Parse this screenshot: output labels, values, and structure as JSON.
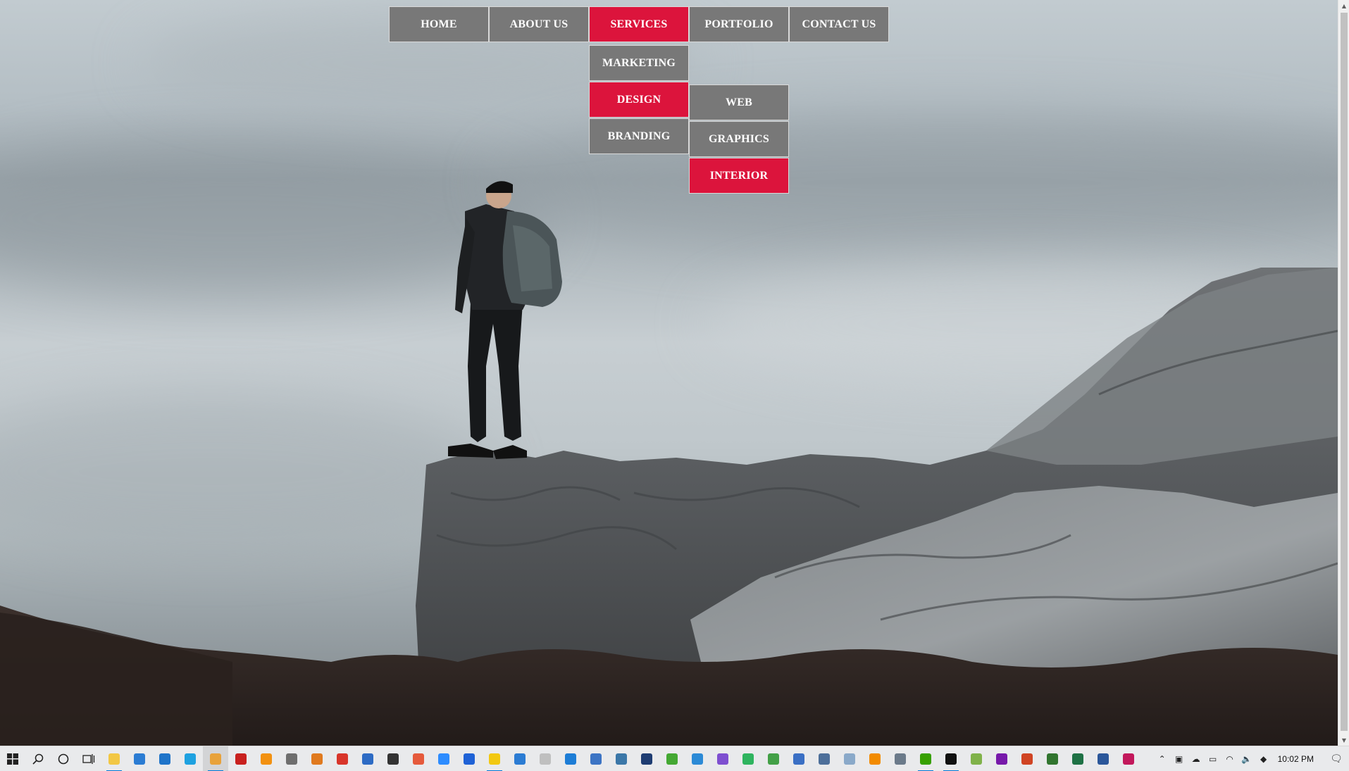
{
  "nav": {
    "items": [
      {
        "label": "HOME"
      },
      {
        "label": "ABOUT US"
      },
      {
        "label": "SERVICES"
      },
      {
        "label": "PORTFOLIO"
      },
      {
        "label": "CONTACT US"
      }
    ],
    "active_item": "SERVICES",
    "services_submenu": [
      {
        "label": "MARKETING"
      },
      {
        "label": "DESIGN"
      },
      {
        "label": "BRANDING"
      }
    ],
    "design_submenu": [
      {
        "label": "WEB"
      },
      {
        "label": "GRAPHICS"
      },
      {
        "label": "INTERIOR"
      }
    ],
    "colors": {
      "button_bg": "#787878",
      "active_bg": "#dc143c",
      "text": "#ffffff"
    }
  },
  "taskbar": {
    "start_icon": "windows-logo-icon",
    "search_icon": "search-icon",
    "cortana_icon": "cortana-circle-icon",
    "task_view_icon": "task-view-icon",
    "apps": [
      {
        "name": "file-explorer-icon",
        "color": "#f2c744"
      },
      {
        "name": "store-icon",
        "color": "#2b7cd3"
      },
      {
        "name": "mail-icon",
        "color": "#1f74c9"
      },
      {
        "name": "internet-explorer-icon",
        "color": "#1ea1e0"
      },
      {
        "name": "chrome-icon",
        "color": "#e8a23a"
      },
      {
        "name": "acrobat-icon",
        "color": "#c8211f"
      },
      {
        "name": "orange-app-icon",
        "color": "#f29111"
      },
      {
        "name": "calculator-icon",
        "color": "#6e6e6e"
      },
      {
        "name": "sublime-icon",
        "color": "#e07a1f"
      },
      {
        "name": "red-app-icon",
        "color": "#d8352a"
      },
      {
        "name": "terminal-icon",
        "color": "#2d6bc4"
      },
      {
        "name": "cmd-icon",
        "color": "#333333"
      },
      {
        "name": "snip-icon",
        "color": "#e55a3c"
      },
      {
        "name": "zoom-icon",
        "color": "#2d8cff"
      },
      {
        "name": "chat-icon",
        "color": "#1f62d6"
      },
      {
        "name": "sticky-notes-icon",
        "color": "#f2c811"
      },
      {
        "name": "photos-icon",
        "color": "#2b7cd3"
      },
      {
        "name": "document-icon",
        "color": "#bfbfbf"
      },
      {
        "name": "edge-icon",
        "color": "#1d7dd6"
      },
      {
        "name": "tool-icon",
        "color": "#3c74c4"
      },
      {
        "name": "python-icon",
        "color": "#3b77a8"
      },
      {
        "name": "intellij-icon",
        "color": "#1e3c72"
      },
      {
        "name": "anaconda-icon",
        "color": "#44a833"
      },
      {
        "name": "vscode-icon",
        "color": "#2c8ad6"
      },
      {
        "name": "visual-studio-icon",
        "color": "#7e4fd0"
      },
      {
        "name": "pycharm-icon",
        "color": "#2fb45f"
      },
      {
        "name": "node-icon",
        "color": "#43a047"
      },
      {
        "name": "tablet-icon",
        "color": "#3a6fc4"
      },
      {
        "name": "network-icon",
        "color": "#4d6f9a"
      },
      {
        "name": "notepad-icon",
        "color": "#8aa9c9"
      },
      {
        "name": "vlc-icon",
        "color": "#f28b00"
      },
      {
        "name": "image-icon",
        "color": "#6b7a8a"
      },
      {
        "name": "upwork-icon",
        "color": "#37a000"
      },
      {
        "name": "pycharm-active-icon",
        "color": "#111111"
      },
      {
        "name": "notepad-plus-icon",
        "color": "#80b24a"
      },
      {
        "name": "onenote-icon",
        "color": "#7719aa"
      },
      {
        "name": "powerpoint-icon",
        "color": "#d04423"
      },
      {
        "name": "project-icon",
        "color": "#31752f"
      },
      {
        "name": "excel-icon",
        "color": "#1e7145"
      },
      {
        "name": "word-icon",
        "color": "#2b579a"
      },
      {
        "name": "pink-app-icon",
        "color": "#c2185b"
      }
    ],
    "clock": "10:02 PM"
  }
}
